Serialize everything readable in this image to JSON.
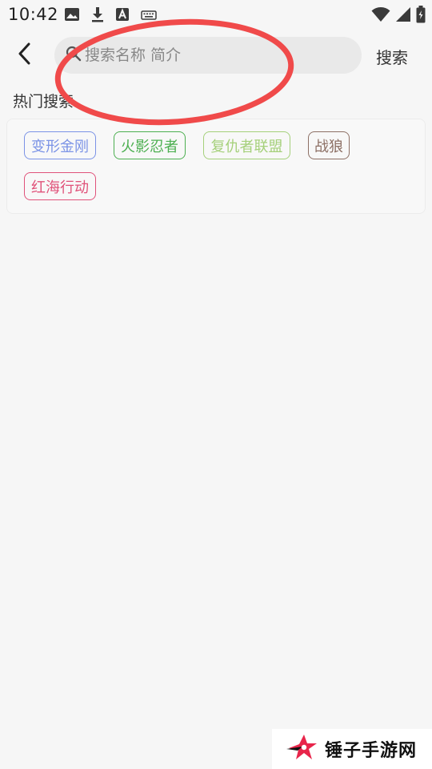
{
  "status_bar": {
    "time": "10:42",
    "left_icons": [
      "image-icon",
      "download-icon",
      "font-icon",
      "keyboard-icon"
    ],
    "right_icons": [
      "wifi-icon",
      "signal-icon",
      "battery-icon"
    ]
  },
  "toolbar": {
    "back_icon": "chevron-left-icon",
    "search_placeholder": "搜索名称 简介",
    "search_value": "",
    "search_button": "搜索"
  },
  "hot_search": {
    "title": "热门搜索",
    "tags": [
      {
        "label": "变形金刚",
        "color": "#7b93e6"
      },
      {
        "label": "火影忍者",
        "color": "#4caf50"
      },
      {
        "label": "复仇者联盟",
        "color": "#a5d07a"
      },
      {
        "label": "战狼",
        "color": "#8d7065"
      },
      {
        "label": "红海行动",
        "color": "#e0527a"
      }
    ]
  },
  "annotation": {
    "color": "#f04a4a"
  },
  "watermark": {
    "text": "锤子手游网"
  }
}
